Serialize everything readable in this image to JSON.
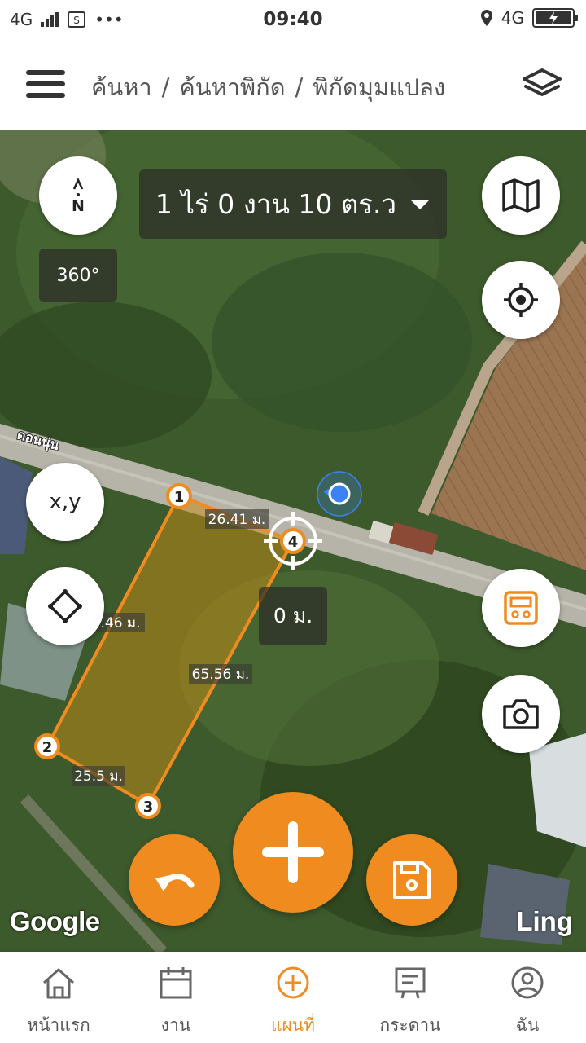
{
  "status_bar": {
    "network_left": "4G",
    "dots": "•••",
    "time": "09:40",
    "network_right": "4G"
  },
  "header": {
    "breadcrumb": [
      "ค้นหา",
      "ค้นหาพิกัด",
      "พิกัดมุมแปลง"
    ],
    "separator": "/"
  },
  "map": {
    "area_text": "1 ไร่ 0 งาน 10 ตร.ว",
    "compass_letter": "N",
    "rotation_text": "360°",
    "xy_button_label": "x,y",
    "road_label": "ดอนนุ่น",
    "distance_readout": "0 ม.",
    "attribution_google": "Google",
    "attribution_credit": "Ling",
    "vertices": [
      "1",
      "2",
      "3",
      "4"
    ],
    "edge_labels": {
      "edge_1_4": "26.41 ม.",
      "edge_1_2": ".46 ม.",
      "edge_3_4": "65.56 ม.",
      "edge_2_3": "25.5 ม."
    },
    "accent_color": "#f08c1f",
    "location_dot_color": "#3b82f6"
  },
  "bottom_nav": {
    "items": [
      {
        "label": "หน้าแรก",
        "icon": "home-icon",
        "active": false
      },
      {
        "label": "งาน",
        "icon": "calendar-icon",
        "active": false
      },
      {
        "label": "แผนที่",
        "icon": "plus-circle-icon",
        "active": true
      },
      {
        "label": "กระดาน",
        "icon": "board-icon",
        "active": false
      },
      {
        "label": "ฉัน",
        "icon": "user-icon",
        "active": false
      }
    ]
  }
}
